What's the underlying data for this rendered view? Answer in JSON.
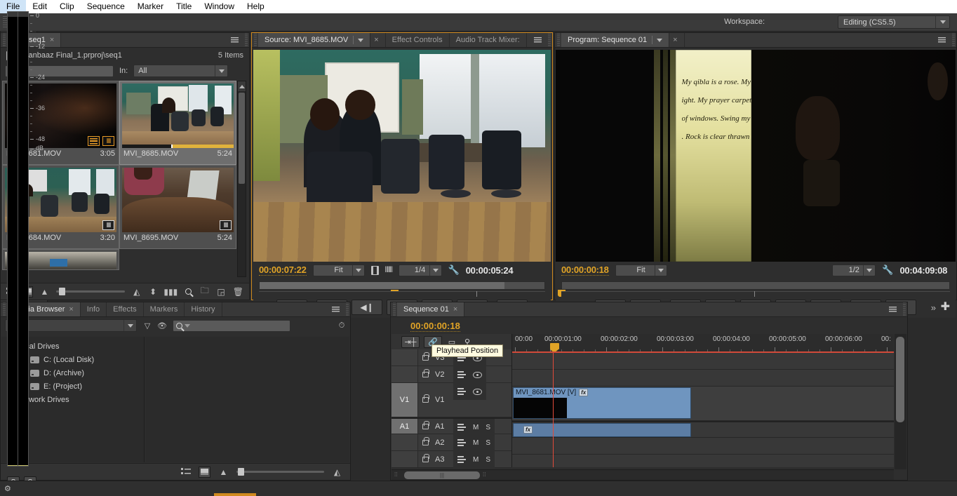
{
  "app": {
    "menus": [
      "File",
      "Edit",
      "Clip",
      "Sequence",
      "Marker",
      "Title",
      "Window",
      "Help"
    ],
    "workspace_label": "Workspace:",
    "workspace_value": "Editing (CS5.5)",
    "accent_color": "#d08a1f"
  },
  "bin": {
    "tab_label": "Bin: seq1",
    "close": "×",
    "path": "jaanbaaz Final_1.prproj\\seq1",
    "items_count": "5 Items",
    "search_placeholder": "",
    "in_label": "In:",
    "in_value": "All",
    "clips": [
      {
        "name": "MVI_8681.MOV",
        "duration": "3:05",
        "selected": false,
        "badges": [
          "film-icon",
          "waveform-icon"
        ],
        "badge_color": "#e79a26",
        "used_bar": false
      },
      {
        "name": "MVI_8685.MOV",
        "duration": "5:24",
        "selected": true,
        "badges": [],
        "used_bar": true
      },
      {
        "name": "MVI_8684.MOV",
        "duration": "3:20",
        "selected": false,
        "badges": [
          "waveform-icon"
        ],
        "badge_color": "#d9d9d9",
        "used_bar": false
      },
      {
        "name": "MVI_8695.MOV",
        "duration": "5:24",
        "selected": false,
        "badges": [
          "waveform-icon"
        ],
        "badge_color": "#d9d9d9",
        "used_bar": false
      }
    ]
  },
  "source_monitor": {
    "tabs": [
      {
        "label": "Source: MVI_8685.MOV",
        "active": true,
        "has_dropdown": true,
        "has_close": true
      },
      {
        "label": "Effect Controls",
        "active": false
      },
      {
        "label": "Audio Track Mixer:",
        "active": false
      }
    ],
    "current_time": "00:00:07:22",
    "fit_value": "Fit",
    "quality_value": "1/4",
    "duration": "00:00:05:24",
    "transport_buttons": [
      "set-in-point",
      "go-to-in-point",
      "step-back",
      "stop",
      "play",
      "step-forward",
      "insert"
    ]
  },
  "program_monitor": {
    "tab_label": "Program: Sequence 01",
    "current_time": "00:00:00:18",
    "fit_value": "Fit",
    "quality_value": "1/2",
    "duration": "00:04:09:08",
    "transport_buttons": [
      "set-in-point",
      "set-out-point",
      "go-to-in-point",
      "step-back",
      "play",
      "step-forward",
      "go-to-out-point",
      "lift",
      "extract"
    ],
    "overlay_text": [
      "My qibla is a rose. My",
      "ight. My prayer carpet",
      "of windows. Swing my",
      ". Rock is clear thrawn"
    ]
  },
  "media_browser": {
    "tabs": [
      {
        "label": "Media Browser",
        "active": true,
        "has_close": true
      },
      {
        "label": "Info",
        "active": false
      },
      {
        "label": "Effects",
        "active": false
      },
      {
        "label": "Markers",
        "active": false
      },
      {
        "label": "History",
        "active": false
      }
    ],
    "search_placeholder": "",
    "dir_select_value": "",
    "tree": [
      {
        "label": "Local Drives",
        "level": 1,
        "expanded": true,
        "icon": "none"
      },
      {
        "label": "C: (Local Disk)",
        "level": 2,
        "expanded": false,
        "icon": "drive-icon"
      },
      {
        "label": "D: (Archive)",
        "level": 2,
        "expanded": false,
        "icon": "drive-icon"
      },
      {
        "label": "E: (Project)",
        "level": 2,
        "expanded": false,
        "icon": "drive-icon"
      },
      {
        "label": "Network Drives",
        "level": 1,
        "expanded": true,
        "icon": "none"
      }
    ]
  },
  "tools": [
    "selection-tool",
    "track-select-tool",
    "ripple-edit-tool",
    "rolling-edit-tool",
    "rate-stretch-tool",
    "razor-tool",
    "slip-tool",
    "slide-tool",
    "pen-tool",
    "hand-tool",
    "zoom-tool"
  ],
  "timeline": {
    "tab_label": "Sequence 01",
    "current_time": "00:00:00:18",
    "tooltip": "Playhead Position",
    "ruler_labels": [
      "00:00",
      "00:00:01:00",
      "00:00:02:00",
      "00:00:03:00",
      "00:00:04:00",
      "00:00:05:00",
      "00:00:06:00",
      "00:"
    ],
    "video_tracks": [
      {
        "name": "V3",
        "source_label": "",
        "source_active": false,
        "locked": false
      },
      {
        "name": "V2",
        "source_label": "",
        "source_active": false,
        "locked": false
      },
      {
        "name": "V1",
        "source_label": "V1",
        "source_active": true,
        "locked": false
      }
    ],
    "audio_tracks": [
      {
        "name": "A1",
        "source_label": "A1",
        "source_active": true,
        "mute": "M",
        "solo": "S"
      },
      {
        "name": "A2",
        "source_label": "",
        "source_active": false,
        "mute": "M",
        "solo": "S"
      },
      {
        "name": "A3",
        "source_label": "",
        "source_active": false,
        "mute": "M",
        "solo": "S"
      }
    ],
    "clips": [
      {
        "track": "V1",
        "name": "MVI_8681.MOV [V]",
        "has_fx": true,
        "color": "#6f95bf"
      },
      {
        "track": "A1",
        "name": "",
        "has_fx": true,
        "color": "#5c7da4"
      }
    ]
  },
  "audio_meters": {
    "scale_labels": [
      "0",
      "-12",
      "-24",
      "-36",
      "-48",
      "dB"
    ],
    "solo_buttons": [
      "S",
      "S"
    ]
  }
}
